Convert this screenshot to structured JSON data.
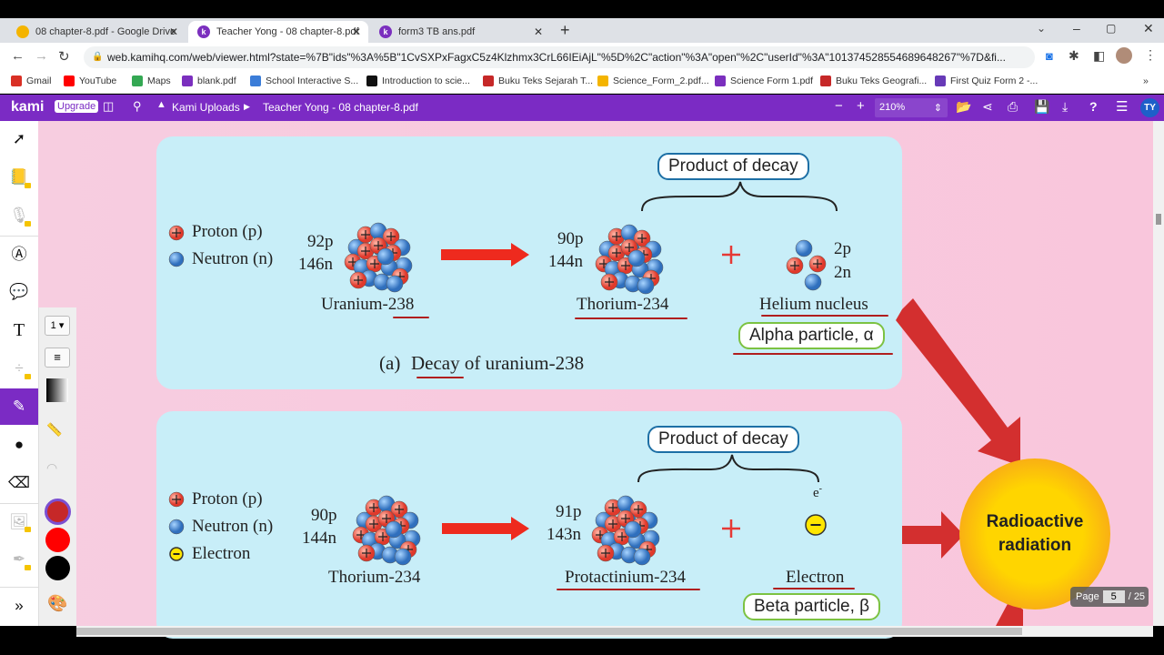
{
  "browser": {
    "tabs": [
      {
        "title": "08 chapter-8.pdf - Google Drive",
        "icon": "google-drive-icon"
      },
      {
        "title": "Teacher Yong - 08 chapter-8.pdf",
        "icon": "kami-icon",
        "active": true
      },
      {
        "title": "form3 TB ans.pdf",
        "icon": "kami-icon"
      }
    ],
    "url": "web.kamihq.com/web/viewer.html?state=%7B\"ids\"%3A%5B\"1CvSXPxFagxC5z4Klzhmx3CrL66IEiAjL\"%5D%2C\"action\"%3A\"open\"%2C\"userId\"%3A\"101374528554689648267\"%7D&fi...",
    "bookmarks": [
      {
        "label": "Gmail",
        "icon": "gmail-icon",
        "color": "#d93025"
      },
      {
        "label": "YouTube",
        "icon": "youtube-icon",
        "color": "#ff0000"
      },
      {
        "label": "Maps",
        "icon": "maps-icon",
        "color": "#34a853"
      },
      {
        "label": "blank.pdf",
        "icon": "kami-icon",
        "color": "#7b2fbe"
      },
      {
        "label": "School Interactive S...",
        "icon": "sis-icon",
        "color": "#3b7dd8"
      },
      {
        "label": "Introduction to scie...",
        "icon": "quizlet-icon",
        "color": "#111"
      },
      {
        "label": "Buku Teks Sejarah T...",
        "icon": "book-icon",
        "color": "#c62828"
      },
      {
        "label": "Science_Form_2.pdf...",
        "icon": "google-drive-icon",
        "color": "#f4b400"
      },
      {
        "label": "Science Form 1.pdf",
        "icon": "kami-icon",
        "color": "#7b2fbe"
      },
      {
        "label": "Buku Teks Geografi...",
        "icon": "book-icon",
        "color": "#c62828"
      },
      {
        "label": "First Quiz Form 2 -...",
        "icon": "forms-icon",
        "color": "#673ab7"
      }
    ]
  },
  "kami": {
    "logo": "kami",
    "upgrade": "Upgrade",
    "breadcrumb_root": "Kami Uploads",
    "doc_title": "Teacher Yong - 08 chapter-8.pdf",
    "zoom": "210%",
    "user_initials": "TY",
    "accent": "#7b2bc4"
  },
  "tools": {
    "stroke_width": "1",
    "colors": [
      "#c62828",
      "#ff0000",
      "#000000"
    ]
  },
  "doc": {
    "a": {
      "legend": [
        "Proton (p)",
        "Neutron (n)"
      ],
      "parent_counts": [
        "92p",
        "146n"
      ],
      "parent": "Uranium-238",
      "daughter_counts": [
        "90p",
        "144n"
      ],
      "daughter": "Thorium-234",
      "product_label": "Product of decay",
      "particle_counts": [
        "2p",
        "2n"
      ],
      "particle": "Helium nucleus",
      "particle_name": "Alpha particle, α",
      "caption_prefix": "(a)",
      "caption": "Decay of uranium-238"
    },
    "b": {
      "legend": [
        "Proton (p)",
        "Neutron (n)",
        "Electron"
      ],
      "parent_counts": [
        "90p",
        "144n"
      ],
      "parent": "Thorium-234",
      "daughter_counts": [
        "91p",
        "143n"
      ],
      "daughter": "Protactinium-234",
      "product_label": "Product of decay",
      "electron_symbol": "e",
      "particle": "Electron",
      "particle_name": "Beta particle, β"
    },
    "radiation": "Radioactive radiation"
  },
  "pager": {
    "label": "Page",
    "current": "5",
    "total": "/ 25"
  }
}
